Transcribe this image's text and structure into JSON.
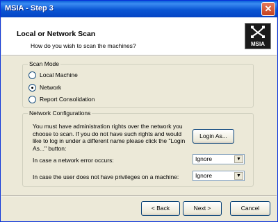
{
  "window": {
    "title": "MSIA - Step 3",
    "close_glyph": "✕"
  },
  "header": {
    "title": "Local or Network Scan",
    "subtitle": "How do you wish to scan the machines?",
    "logo_text": "MSIA"
  },
  "scan_mode": {
    "label": "Scan Mode",
    "options": [
      {
        "label": "Local Machine",
        "selected": false
      },
      {
        "label": "Network",
        "selected": true
      },
      {
        "label": "Report Consolidation",
        "selected": false
      }
    ]
  },
  "network": {
    "label": "Network Configurations",
    "description": "You must have administration rights over the network you choose to scan.  If you do not have such rights and would like to log in under a different name please click the \"Login As...\" button:",
    "login_button": "Login As...",
    "error_label": "In case a network error occurs:",
    "error_value": "Ignore",
    "privilege_label": "In case the user does not have privileges on a machine:",
    "privilege_value": "Ignore"
  },
  "footer": {
    "back": "< Back",
    "next": "Next >",
    "cancel": "Cancel"
  },
  "icons": {
    "close": "close-icon",
    "dropdown": "chevron-down-icon",
    "logo": "msia-logo-icon"
  }
}
